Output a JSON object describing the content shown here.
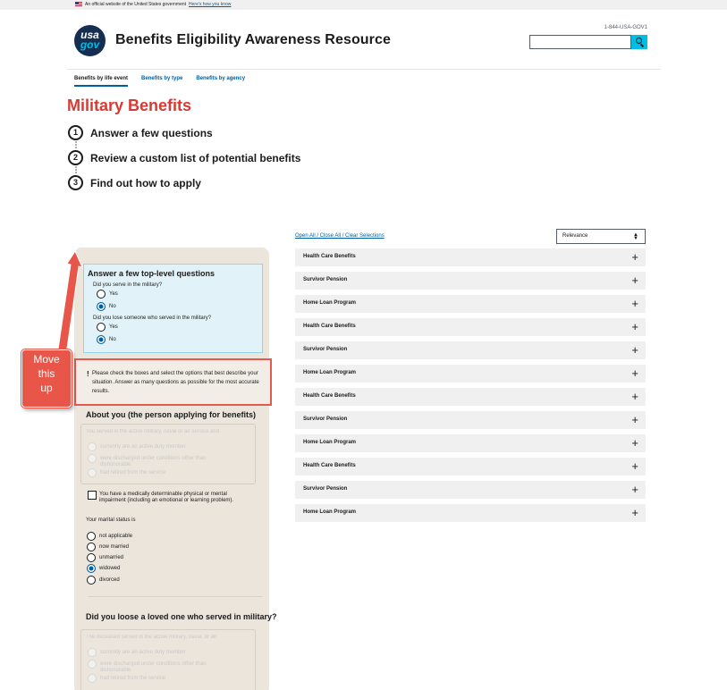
{
  "banner": {
    "text": "An official website of the United States government",
    "link": "Here's how you know"
  },
  "logo": {
    "line1": "usa",
    "line2": "gov"
  },
  "site_title": "Benefits Eligibility Awareness Resource",
  "phone": "1-844-USA-GOV1",
  "search": {
    "placeholder": ""
  },
  "nav": [
    "Benefits by life event",
    "Benefits by type",
    "Benefits by agency"
  ],
  "page_title": "Military Benefits",
  "steps": [
    {
      "num": "1",
      "label": "Answer a few questions"
    },
    {
      "num": "2",
      "label": "Review a custom list of potential benefits"
    },
    {
      "num": "3",
      "label": "Find out how to apply"
    }
  ],
  "results": {
    "controls_link": "Open All / Close All / Clear Selections",
    "sort_value": "Relevance",
    "items": [
      "Health Care Benefits",
      "Survivor Pension",
      "Home Loan Program",
      "Health Care Benefits",
      "Survivor Pension",
      "Home Loan Program",
      "Health Care Benefits",
      "Survivor Pension",
      "Home Loan Program",
      "Health Care Benefits",
      "Survivor Pension",
      "Home Loan Program"
    ],
    "expand_glyph": "+"
  },
  "questions": {
    "title": "Answer a few top-level questions",
    "q1": "Did you serve in the military?",
    "q2": "Did you lose someone who served in the military?",
    "yes": "Yes",
    "no": "No"
  },
  "alert": {
    "bang": "!",
    "message": "Please check the boxes and select the options that best describe your situation. Answer as many questions as possible for the most accurate results."
  },
  "about": {
    "title": "About you (the person applying for benefits)",
    "fieldset_legend": "You served in the active military, naval or air service and",
    "options": [
      "currently are an active duty member",
      "were discharged under conditions other than dishonorable",
      "had retired from the service"
    ],
    "checkbox_label": "You have a medically determinable physical or mental impairment (including an emotional or learning problem).",
    "marital_label": "Your marital status is",
    "marital_options": [
      "not applicable",
      "now married",
      "unmarried",
      "widowed",
      "divorced"
    ]
  },
  "loved_one": {
    "title": "Did you loose a loved one who served in military?",
    "fieldset_legend": "The deceased served in the active military, naval, or air",
    "options": [
      "currently are an active duty member",
      "were discharged under conditions other than dishonorable",
      "had retired from the service"
    ]
  },
  "annotation": {
    "line1": "Move",
    "line2": "this",
    "line3": "up"
  },
  "colors": {
    "title_red": "#d83933",
    "link_blue": "#005ea2",
    "search_cyan": "#00bde3",
    "callout": "#e8564a"
  }
}
